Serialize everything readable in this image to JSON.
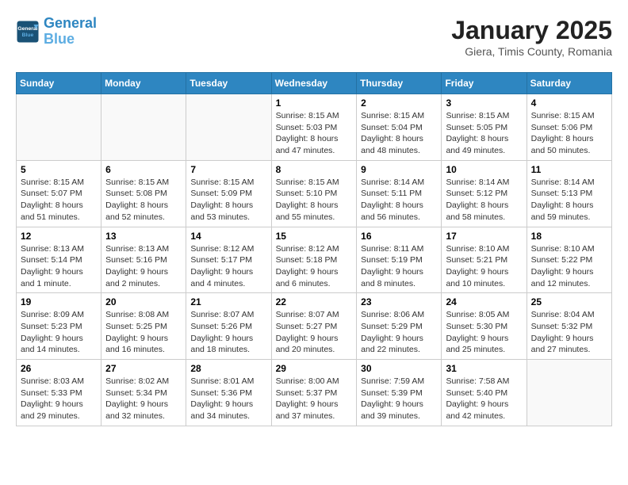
{
  "header": {
    "logo_line1": "General",
    "logo_line2": "Blue",
    "title": "January 2025",
    "subtitle": "Giera, Timis County, Romania"
  },
  "calendar": {
    "days_of_week": [
      "Sunday",
      "Monday",
      "Tuesday",
      "Wednesday",
      "Thursday",
      "Friday",
      "Saturday"
    ],
    "weeks": [
      [
        {
          "day": "",
          "info": ""
        },
        {
          "day": "",
          "info": ""
        },
        {
          "day": "",
          "info": ""
        },
        {
          "day": "1",
          "info": "Sunrise: 8:15 AM\nSunset: 5:03 PM\nDaylight: 8 hours and 47 minutes."
        },
        {
          "day": "2",
          "info": "Sunrise: 8:15 AM\nSunset: 5:04 PM\nDaylight: 8 hours and 48 minutes."
        },
        {
          "day": "3",
          "info": "Sunrise: 8:15 AM\nSunset: 5:05 PM\nDaylight: 8 hours and 49 minutes."
        },
        {
          "day": "4",
          "info": "Sunrise: 8:15 AM\nSunset: 5:06 PM\nDaylight: 8 hours and 50 minutes."
        }
      ],
      [
        {
          "day": "5",
          "info": "Sunrise: 8:15 AM\nSunset: 5:07 PM\nDaylight: 8 hours and 51 minutes."
        },
        {
          "day": "6",
          "info": "Sunrise: 8:15 AM\nSunset: 5:08 PM\nDaylight: 8 hours and 52 minutes."
        },
        {
          "day": "7",
          "info": "Sunrise: 8:15 AM\nSunset: 5:09 PM\nDaylight: 8 hours and 53 minutes."
        },
        {
          "day": "8",
          "info": "Sunrise: 8:15 AM\nSunset: 5:10 PM\nDaylight: 8 hours and 55 minutes."
        },
        {
          "day": "9",
          "info": "Sunrise: 8:14 AM\nSunset: 5:11 PM\nDaylight: 8 hours and 56 minutes."
        },
        {
          "day": "10",
          "info": "Sunrise: 8:14 AM\nSunset: 5:12 PM\nDaylight: 8 hours and 58 minutes."
        },
        {
          "day": "11",
          "info": "Sunrise: 8:14 AM\nSunset: 5:13 PM\nDaylight: 8 hours and 59 minutes."
        }
      ],
      [
        {
          "day": "12",
          "info": "Sunrise: 8:13 AM\nSunset: 5:14 PM\nDaylight: 9 hours and 1 minute."
        },
        {
          "day": "13",
          "info": "Sunrise: 8:13 AM\nSunset: 5:16 PM\nDaylight: 9 hours and 2 minutes."
        },
        {
          "day": "14",
          "info": "Sunrise: 8:12 AM\nSunset: 5:17 PM\nDaylight: 9 hours and 4 minutes."
        },
        {
          "day": "15",
          "info": "Sunrise: 8:12 AM\nSunset: 5:18 PM\nDaylight: 9 hours and 6 minutes."
        },
        {
          "day": "16",
          "info": "Sunrise: 8:11 AM\nSunset: 5:19 PM\nDaylight: 9 hours and 8 minutes."
        },
        {
          "day": "17",
          "info": "Sunrise: 8:10 AM\nSunset: 5:21 PM\nDaylight: 9 hours and 10 minutes."
        },
        {
          "day": "18",
          "info": "Sunrise: 8:10 AM\nSunset: 5:22 PM\nDaylight: 9 hours and 12 minutes."
        }
      ],
      [
        {
          "day": "19",
          "info": "Sunrise: 8:09 AM\nSunset: 5:23 PM\nDaylight: 9 hours and 14 minutes."
        },
        {
          "day": "20",
          "info": "Sunrise: 8:08 AM\nSunset: 5:25 PM\nDaylight: 9 hours and 16 minutes."
        },
        {
          "day": "21",
          "info": "Sunrise: 8:07 AM\nSunset: 5:26 PM\nDaylight: 9 hours and 18 minutes."
        },
        {
          "day": "22",
          "info": "Sunrise: 8:07 AM\nSunset: 5:27 PM\nDaylight: 9 hours and 20 minutes."
        },
        {
          "day": "23",
          "info": "Sunrise: 8:06 AM\nSunset: 5:29 PM\nDaylight: 9 hours and 22 minutes."
        },
        {
          "day": "24",
          "info": "Sunrise: 8:05 AM\nSunset: 5:30 PM\nDaylight: 9 hours and 25 minutes."
        },
        {
          "day": "25",
          "info": "Sunrise: 8:04 AM\nSunset: 5:32 PM\nDaylight: 9 hours and 27 minutes."
        }
      ],
      [
        {
          "day": "26",
          "info": "Sunrise: 8:03 AM\nSunset: 5:33 PM\nDaylight: 9 hours and 29 minutes."
        },
        {
          "day": "27",
          "info": "Sunrise: 8:02 AM\nSunset: 5:34 PM\nDaylight: 9 hours and 32 minutes."
        },
        {
          "day": "28",
          "info": "Sunrise: 8:01 AM\nSunset: 5:36 PM\nDaylight: 9 hours and 34 minutes."
        },
        {
          "day": "29",
          "info": "Sunrise: 8:00 AM\nSunset: 5:37 PM\nDaylight: 9 hours and 37 minutes."
        },
        {
          "day": "30",
          "info": "Sunrise: 7:59 AM\nSunset: 5:39 PM\nDaylight: 9 hours and 39 minutes."
        },
        {
          "day": "31",
          "info": "Sunrise: 7:58 AM\nSunset: 5:40 PM\nDaylight: 9 hours and 42 minutes."
        },
        {
          "day": "",
          "info": ""
        }
      ]
    ]
  }
}
